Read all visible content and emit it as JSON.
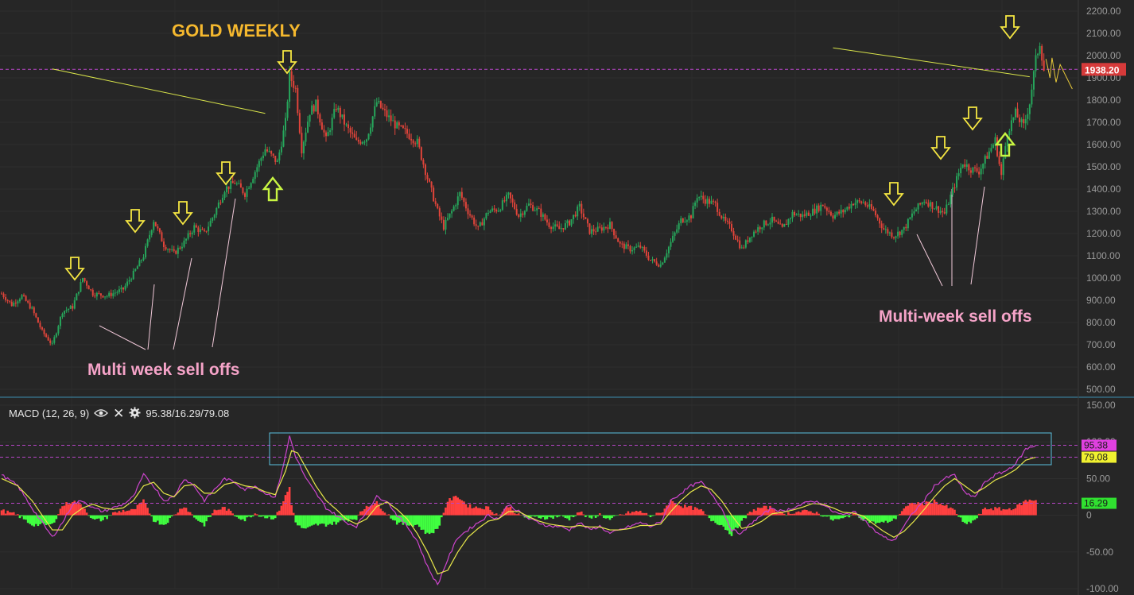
{
  "chart_data": [
    {
      "type": "candlestick",
      "title": "GOLD WEEKLY",
      "ylim": [
        480,
        2220
      ],
      "yticks": [
        500,
        600,
        700,
        800,
        900,
        1000,
        1100,
        1200,
        1300,
        1400,
        1500,
        1600,
        1700,
        1800,
        1900,
        2000,
        2100,
        2200
      ],
      "ytick_labels": [
        "500.00",
        "600.00",
        "700.00",
        "800.00",
        "900.00",
        "1000.00",
        "1100.00",
        "1200.00",
        "1300.00",
        "1400.00",
        "1500.00",
        "1600.00",
        "1700.00",
        "1800.00",
        "1900.00",
        "2000.00",
        "2100.00",
        "2200.00"
      ],
      "grid": true,
      "up_color": "#26a65b",
      "down_color": "#e0443a",
      "last_price": 1938.2,
      "last_price_label": "1938.20",
      "last_price_color": "#d63a3a",
      "price_line_color": "#b845c8",
      "path_keypoints": [
        [
          0,
          930
        ],
        [
          5,
          880
        ],
        [
          10,
          920
        ],
        [
          15,
          860
        ],
        [
          20,
          760
        ],
        [
          25,
          700
        ],
        [
          30,
          850
        ],
        [
          35,
          870
        ],
        [
          40,
          1000
        ],
        [
          45,
          930
        ],
        [
          52,
          920
        ],
        [
          60,
          950
        ],
        [
          65,
          1020
        ],
        [
          70,
          1100
        ],
        [
          75,
          1260
        ],
        [
          80,
          1150
        ],
        [
          85,
          1110
        ],
        [
          90,
          1160
        ],
        [
          95,
          1230
        ],
        [
          100,
          1200
        ],
        [
          105,
          1290
        ],
        [
          110,
          1400
        ],
        [
          115,
          1430
        ],
        [
          120,
          1380
        ],
        [
          125,
          1480
        ],
        [
          130,
          1580
        ],
        [
          136,
          1520
        ],
        [
          140,
          1700
        ],
        [
          142,
          1910
        ],
        [
          145,
          1850
        ],
        [
          148,
          1580
        ],
        [
          152,
          1750
        ],
        [
          155,
          1780
        ],
        [
          160,
          1620
        ],
        [
          165,
          1770
        ],
        [
          170,
          1680
        ],
        [
          175,
          1610
        ],
        [
          180,
          1630
        ],
        [
          185,
          1790
        ],
        [
          190,
          1730
        ],
        [
          195,
          1680
        ],
        [
          200,
          1650
        ],
        [
          205,
          1610
        ],
        [
          210,
          1450
        ],
        [
          215,
          1300
        ],
        [
          218,
          1230
        ],
        [
          222,
          1300
        ],
        [
          226,
          1380
        ],
        [
          230,
          1300
        ],
        [
          235,
          1220
        ],
        [
          240,
          1300
        ],
        [
          245,
          1310
        ],
        [
          250,
          1370
        ],
        [
          255,
          1280
        ],
        [
          260,
          1330
        ],
        [
          265,
          1300
        ],
        [
          270,
          1240
        ],
        [
          275,
          1220
        ],
        [
          280,
          1250
        ],
        [
          285,
          1320
        ],
        [
          290,
          1210
        ],
        [
          295,
          1220
        ],
        [
          300,
          1240
        ],
        [
          305,
          1150
        ],
        [
          310,
          1130
        ],
        [
          315,
          1140
        ],
        [
          320,
          1080
        ],
        [
          325,
          1060
        ],
        [
          330,
          1160
        ],
        [
          335,
          1260
        ],
        [
          340,
          1280
        ],
        [
          343,
          1370
        ],
        [
          347,
          1350
        ],
        [
          352,
          1330
        ],
        [
          356,
          1260
        ],
        [
          360,
          1220
        ],
        [
          365,
          1130
        ],
        [
          370,
          1200
        ],
        [
          375,
          1240
        ],
        [
          380,
          1260
        ],
        [
          385,
          1220
        ],
        [
          390,
          1290
        ],
        [
          395,
          1280
        ],
        [
          400,
          1300
        ],
        [
          405,
          1330
        ],
        [
          410,
          1280
        ],
        [
          415,
          1300
        ],
        [
          420,
          1340
        ],
        [
          425,
          1340
        ],
        [
          430,
          1300
        ],
        [
          435,
          1220
        ],
        [
          440,
          1190
        ],
        [
          445,
          1220
        ],
        [
          450,
          1300
        ],
        [
          455,
          1350
        ],
        [
          460,
          1320
        ],
        [
          465,
          1290
        ],
        [
          470,
          1420
        ],
        [
          474,
          1520
        ],
        [
          478,
          1490
        ],
        [
          482,
          1480
        ],
        [
          486,
          1550
        ],
        [
          490,
          1620
        ],
        [
          493,
          1460
        ],
        [
          496,
          1660
        ],
        [
          500,
          1740
        ],
        [
          504,
          1680
        ],
        [
          507,
          1790
        ],
        [
          510,
          1980
        ],
        [
          512,
          2060
        ],
        [
          514,
          1938.2
        ]
      ],
      "annotations": {
        "left_label": "Multi week sell offs",
        "right_label": "Multi-week sell offs",
        "label_color": "#f5a3c8",
        "title_color": "#f5b82e",
        "down_arrow_weeks": [
          37,
          67,
          92,
          113,
          143,
          466,
          485,
          499,
          521
        ],
        "up_arrow_weeks": [
          137,
          514
        ],
        "arrow_color": "#f5e642",
        "arrow_up_color": "#c8f542",
        "trendlines": [
          {
            "from": [
              25,
              1940
            ],
            "to": [
              130,
              1740
            ]
          },
          {
            "from": [
              410,
              2035
            ],
            "to": [
              507,
              1905
            ]
          }
        ],
        "trendline_color": "#d8e34a",
        "projection_color": "#e8c93a"
      }
    },
    {
      "type": "macd",
      "name": "MACD (12, 26, 9)",
      "values_text": "95.38/16.29/79.08",
      "ylim": [
        -100,
        150
      ],
      "yticks": [
        -100,
        -50,
        0,
        50,
        100,
        150
      ],
      "ytick_labels": [
        "-100.00",
        "-50.00",
        "0",
        "50.00",
        "100.00",
        "150.00"
      ],
      "macd_color": "#cc44cc",
      "signal_color": "#e8e84a",
      "hist_up_color": "#ff4040",
      "hist_down_color": "#40ff40",
      "macd_label": "95.38",
      "signal_label": "79.08",
      "hist_label": "16.29",
      "macd_last": 95.38,
      "signal_last": 79.08,
      "hist_last": 16.29,
      "highlight_box_color": "#5bc0de",
      "macd_keypoints": [
        [
          0,
          55
        ],
        [
          8,
          40
        ],
        [
          15,
          10
        ],
        [
          20,
          -10
        ],
        [
          25,
          -30
        ],
        [
          30,
          -10
        ],
        [
          35,
          15
        ],
        [
          40,
          20
        ],
        [
          45,
          10
        ],
        [
          50,
          5
        ],
        [
          55,
          10
        ],
        [
          60,
          15
        ],
        [
          65,
          25
        ],
        [
          70,
          55
        ],
        [
          75,
          40
        ],
        [
          80,
          20
        ],
        [
          85,
          25
        ],
        [
          90,
          50
        ],
        [
          95,
          40
        ],
        [
          100,
          20
        ],
        [
          105,
          35
        ],
        [
          110,
          50
        ],
        [
          115,
          45
        ],
        [
          120,
          35
        ],
        [
          125,
          40
        ],
        [
          130,
          30
        ],
        [
          135,
          25
        ],
        [
          140,
          80
        ],
        [
          142,
          108
        ],
        [
          145,
          80
        ],
        [
          150,
          50
        ],
        [
          155,
          30
        ],
        [
          160,
          10
        ],
        [
          165,
          0
        ],
        [
          170,
          -10
        ],
        [
          175,
          -15
        ],
        [
          180,
          5
        ],
        [
          185,
          25
        ],
        [
          190,
          20
        ],
        [
          195,
          0
        ],
        [
          200,
          -15
        ],
        [
          205,
          -35
        ],
        [
          210,
          -70
        ],
        [
          215,
          -95
        ],
        [
          220,
          -60
        ],
        [
          225,
          -30
        ],
        [
          230,
          -20
        ],
        [
          235,
          -10
        ],
        [
          240,
          0
        ],
        [
          245,
          -5
        ],
        [
          250,
          15
        ],
        [
          255,
          5
        ],
        [
          260,
          -5
        ],
        [
          265,
          -10
        ],
        [
          270,
          -15
        ],
        [
          275,
          -15
        ],
        [
          280,
          -20
        ],
        [
          285,
          -10
        ],
        [
          290,
          -20
        ],
        [
          295,
          -15
        ],
        [
          300,
          -25
        ],
        [
          305,
          -20
        ],
        [
          310,
          -15
        ],
        [
          315,
          -10
        ],
        [
          320,
          -15
        ],
        [
          325,
          -10
        ],
        [
          330,
          20
        ],
        [
          335,
          30
        ],
        [
          340,
          40
        ],
        [
          345,
          45
        ],
        [
          350,
          30
        ],
        [
          355,
          10
        ],
        [
          360,
          -20
        ],
        [
          365,
          -25
        ],
        [
          370,
          -10
        ],
        [
          375,
          0
        ],
        [
          380,
          10
        ],
        [
          385,
          5
        ],
        [
          390,
          10
        ],
        [
          395,
          15
        ],
        [
          400,
          20
        ],
        [
          405,
          15
        ],
        [
          410,
          5
        ],
        [
          415,
          0
        ],
        [
          420,
          5
        ],
        [
          425,
          -5
        ],
        [
          430,
          -20
        ],
        [
          435,
          -30
        ],
        [
          440,
          -35
        ],
        [
          445,
          -15
        ],
        [
          450,
          5
        ],
        [
          455,
          20
        ],
        [
          460,
          40
        ],
        [
          465,
          50
        ],
        [
          470,
          55
        ],
        [
          475,
          30
        ],
        [
          480,
          25
        ],
        [
          485,
          45
        ],
        [
          490,
          55
        ],
        [
          495,
          60
        ],
        [
          500,
          70
        ],
        [
          505,
          90
        ],
        [
          510,
          95.38
        ]
      ],
      "signal_keypoints": [
        [
          0,
          50
        ],
        [
          8,
          40
        ],
        [
          15,
          20
        ],
        [
          20,
          0
        ],
        [
          25,
          -20
        ],
        [
          30,
          -20
        ],
        [
          35,
          0
        ],
        [
          40,
          10
        ],
        [
          45,
          15
        ],
        [
          50,
          10
        ],
        [
          55,
          8
        ],
        [
          60,
          10
        ],
        [
          65,
          20
        ],
        [
          70,
          40
        ],
        [
          75,
          45
        ],
        [
          80,
          30
        ],
        [
          85,
          25
        ],
        [
          90,
          40
        ],
        [
          95,
          42
        ],
        [
          100,
          30
        ],
        [
          105,
          30
        ],
        [
          110,
          42
        ],
        [
          115,
          45
        ],
        [
          120,
          40
        ],
        [
          125,
          38
        ],
        [
          130,
          32
        ],
        [
          135,
          28
        ],
        [
          140,
          60
        ],
        [
          143,
          88
        ],
        [
          146,
          85
        ],
        [
          150,
          65
        ],
        [
          155,
          40
        ],
        [
          160,
          20
        ],
        [
          165,
          8
        ],
        [
          170,
          -5
        ],
        [
          175,
          -12
        ],
        [
          180,
          -5
        ],
        [
          185,
          12
        ],
        [
          190,
          18
        ],
        [
          195,
          8
        ],
        [
          200,
          -5
        ],
        [
          205,
          -25
        ],
        [
          210,
          -50
        ],
        [
          215,
          -80
        ],
        [
          220,
          -75
        ],
        [
          225,
          -50
        ],
        [
          230,
          -30
        ],
        [
          235,
          -18
        ],
        [
          240,
          -8
        ],
        [
          245,
          -5
        ],
        [
          250,
          5
        ],
        [
          255,
          5
        ],
        [
          260,
          -2
        ],
        [
          265,
          -8
        ],
        [
          270,
          -12
        ],
        [
          275,
          -14
        ],
        [
          280,
          -16
        ],
        [
          285,
          -14
        ],
        [
          290,
          -16
        ],
        [
          295,
          -16
        ],
        [
          300,
          -20
        ],
        [
          305,
          -20
        ],
        [
          310,
          -18
        ],
        [
          315,
          -14
        ],
        [
          320,
          -14
        ],
        [
          325,
          -12
        ],
        [
          330,
          5
        ],
        [
          335,
          20
        ],
        [
          340,
          32
        ],
        [
          345,
          40
        ],
        [
          350,
          35
        ],
        [
          355,
          20
        ],
        [
          360,
          0
        ],
        [
          365,
          -18
        ],
        [
          370,
          -15
        ],
        [
          375,
          -8
        ],
        [
          380,
          2
        ],
        [
          385,
          4
        ],
        [
          390,
          7
        ],
        [
          395,
          11
        ],
        [
          400,
          16
        ],
        [
          405,
          15
        ],
        [
          410,
          10
        ],
        [
          415,
          4
        ],
        [
          420,
          3
        ],
        [
          425,
          -1
        ],
        [
          430,
          -12
        ],
        [
          435,
          -22
        ],
        [
          440,
          -30
        ],
        [
          445,
          -22
        ],
        [
          450,
          -8
        ],
        [
          455,
          8
        ],
        [
          460,
          25
        ],
        [
          465,
          40
        ],
        [
          470,
          50
        ],
        [
          475,
          40
        ],
        [
          480,
          30
        ],
        [
          485,
          38
        ],
        [
          490,
          48
        ],
        [
          495,
          54
        ],
        [
          500,
          62
        ],
        [
          505,
          75
        ],
        [
          510,
          79.08
        ]
      ]
    }
  ]
}
